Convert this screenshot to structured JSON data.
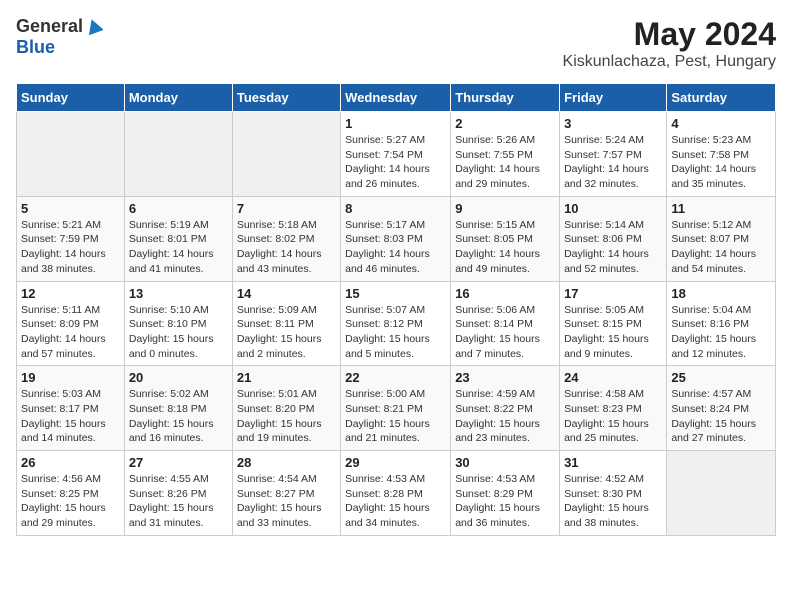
{
  "logo": {
    "general": "General",
    "blue": "Blue"
  },
  "title": "May 2024",
  "subtitle": "Kiskunlachaza, Pest, Hungary",
  "days": [
    "Sunday",
    "Monday",
    "Tuesday",
    "Wednesday",
    "Thursday",
    "Friday",
    "Saturday"
  ],
  "weeks": [
    [
      {
        "date": "",
        "sunrise": "",
        "sunset": "",
        "daylight": ""
      },
      {
        "date": "",
        "sunrise": "",
        "sunset": "",
        "daylight": ""
      },
      {
        "date": "",
        "sunrise": "",
        "sunset": "",
        "daylight": ""
      },
      {
        "date": "1",
        "sunrise": "Sunrise: 5:27 AM",
        "sunset": "Sunset: 7:54 PM",
        "daylight": "Daylight: 14 hours and 26 minutes."
      },
      {
        "date": "2",
        "sunrise": "Sunrise: 5:26 AM",
        "sunset": "Sunset: 7:55 PM",
        "daylight": "Daylight: 14 hours and 29 minutes."
      },
      {
        "date": "3",
        "sunrise": "Sunrise: 5:24 AM",
        "sunset": "Sunset: 7:57 PM",
        "daylight": "Daylight: 14 hours and 32 minutes."
      },
      {
        "date": "4",
        "sunrise": "Sunrise: 5:23 AM",
        "sunset": "Sunset: 7:58 PM",
        "daylight": "Daylight: 14 hours and 35 minutes."
      }
    ],
    [
      {
        "date": "5",
        "sunrise": "Sunrise: 5:21 AM",
        "sunset": "Sunset: 7:59 PM",
        "daylight": "Daylight: 14 hours and 38 minutes."
      },
      {
        "date": "6",
        "sunrise": "Sunrise: 5:19 AM",
        "sunset": "Sunset: 8:01 PM",
        "daylight": "Daylight: 14 hours and 41 minutes."
      },
      {
        "date": "7",
        "sunrise": "Sunrise: 5:18 AM",
        "sunset": "Sunset: 8:02 PM",
        "daylight": "Daylight: 14 hours and 43 minutes."
      },
      {
        "date": "8",
        "sunrise": "Sunrise: 5:17 AM",
        "sunset": "Sunset: 8:03 PM",
        "daylight": "Daylight: 14 hours and 46 minutes."
      },
      {
        "date": "9",
        "sunrise": "Sunrise: 5:15 AM",
        "sunset": "Sunset: 8:05 PM",
        "daylight": "Daylight: 14 hours and 49 minutes."
      },
      {
        "date": "10",
        "sunrise": "Sunrise: 5:14 AM",
        "sunset": "Sunset: 8:06 PM",
        "daylight": "Daylight: 14 hours and 52 minutes."
      },
      {
        "date": "11",
        "sunrise": "Sunrise: 5:12 AM",
        "sunset": "Sunset: 8:07 PM",
        "daylight": "Daylight: 14 hours and 54 minutes."
      }
    ],
    [
      {
        "date": "12",
        "sunrise": "Sunrise: 5:11 AM",
        "sunset": "Sunset: 8:09 PM",
        "daylight": "Daylight: 14 hours and 57 minutes."
      },
      {
        "date": "13",
        "sunrise": "Sunrise: 5:10 AM",
        "sunset": "Sunset: 8:10 PM",
        "daylight": "Daylight: 15 hours and 0 minutes."
      },
      {
        "date": "14",
        "sunrise": "Sunrise: 5:09 AM",
        "sunset": "Sunset: 8:11 PM",
        "daylight": "Daylight: 15 hours and 2 minutes."
      },
      {
        "date": "15",
        "sunrise": "Sunrise: 5:07 AM",
        "sunset": "Sunset: 8:12 PM",
        "daylight": "Daylight: 15 hours and 5 minutes."
      },
      {
        "date": "16",
        "sunrise": "Sunrise: 5:06 AM",
        "sunset": "Sunset: 8:14 PM",
        "daylight": "Daylight: 15 hours and 7 minutes."
      },
      {
        "date": "17",
        "sunrise": "Sunrise: 5:05 AM",
        "sunset": "Sunset: 8:15 PM",
        "daylight": "Daylight: 15 hours and 9 minutes."
      },
      {
        "date": "18",
        "sunrise": "Sunrise: 5:04 AM",
        "sunset": "Sunset: 8:16 PM",
        "daylight": "Daylight: 15 hours and 12 minutes."
      }
    ],
    [
      {
        "date": "19",
        "sunrise": "Sunrise: 5:03 AM",
        "sunset": "Sunset: 8:17 PM",
        "daylight": "Daylight: 15 hours and 14 minutes."
      },
      {
        "date": "20",
        "sunrise": "Sunrise: 5:02 AM",
        "sunset": "Sunset: 8:18 PM",
        "daylight": "Daylight: 15 hours and 16 minutes."
      },
      {
        "date": "21",
        "sunrise": "Sunrise: 5:01 AM",
        "sunset": "Sunset: 8:20 PM",
        "daylight": "Daylight: 15 hours and 19 minutes."
      },
      {
        "date": "22",
        "sunrise": "Sunrise: 5:00 AM",
        "sunset": "Sunset: 8:21 PM",
        "daylight": "Daylight: 15 hours and 21 minutes."
      },
      {
        "date": "23",
        "sunrise": "Sunrise: 4:59 AM",
        "sunset": "Sunset: 8:22 PM",
        "daylight": "Daylight: 15 hours and 23 minutes."
      },
      {
        "date": "24",
        "sunrise": "Sunrise: 4:58 AM",
        "sunset": "Sunset: 8:23 PM",
        "daylight": "Daylight: 15 hours and 25 minutes."
      },
      {
        "date": "25",
        "sunrise": "Sunrise: 4:57 AM",
        "sunset": "Sunset: 8:24 PM",
        "daylight": "Daylight: 15 hours and 27 minutes."
      }
    ],
    [
      {
        "date": "26",
        "sunrise": "Sunrise: 4:56 AM",
        "sunset": "Sunset: 8:25 PM",
        "daylight": "Daylight: 15 hours and 29 minutes."
      },
      {
        "date": "27",
        "sunrise": "Sunrise: 4:55 AM",
        "sunset": "Sunset: 8:26 PM",
        "daylight": "Daylight: 15 hours and 31 minutes."
      },
      {
        "date": "28",
        "sunrise": "Sunrise: 4:54 AM",
        "sunset": "Sunset: 8:27 PM",
        "daylight": "Daylight: 15 hours and 33 minutes."
      },
      {
        "date": "29",
        "sunrise": "Sunrise: 4:53 AM",
        "sunset": "Sunset: 8:28 PM",
        "daylight": "Daylight: 15 hours and 34 minutes."
      },
      {
        "date": "30",
        "sunrise": "Sunrise: 4:53 AM",
        "sunset": "Sunset: 8:29 PM",
        "daylight": "Daylight: 15 hours and 36 minutes."
      },
      {
        "date": "31",
        "sunrise": "Sunrise: 4:52 AM",
        "sunset": "Sunset: 8:30 PM",
        "daylight": "Daylight: 15 hours and 38 minutes."
      },
      {
        "date": "",
        "sunrise": "",
        "sunset": "",
        "daylight": ""
      }
    ]
  ]
}
